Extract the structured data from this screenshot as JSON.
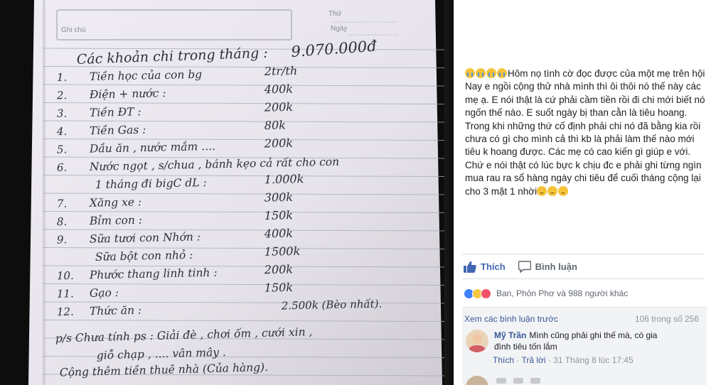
{
  "image": {
    "header": {
      "thu_label": "Thứ",
      "ngay_label": "Ngày",
      "ghi_chu_label": "Ghi chú"
    },
    "note": {
      "title": "Các khoản chi trong tháng :",
      "total": "9.070.000đ",
      "items": [
        {
          "num": "1.",
          "desc": "Tiền học của con bg",
          "amount": "2tr/th"
        },
        {
          "num": "2.",
          "desc": "Điện + nước :",
          "amount": "400k"
        },
        {
          "num": "3.",
          "desc": "Tiền ĐT :",
          "amount": "200k"
        },
        {
          "num": "4.",
          "desc": "Tiền Gas :",
          "amount": "80k"
        },
        {
          "num": "5.",
          "desc": "Dầu ăn , nước mắm ....",
          "amount": "200k"
        },
        {
          "num": "6.",
          "desc": "Nước ngọt , s/chua , bánh kẹo cả rất cho con",
          "amount": ""
        },
        {
          "num": "",
          "desc": "1 tháng đi bigC dL :",
          "amount": "1.000k"
        },
        {
          "num": "7.",
          "desc": "Xăng xe :",
          "amount": "300k"
        },
        {
          "num": "8.",
          "desc": "Bỉm con :",
          "amount": "150k"
        },
        {
          "num": "9.",
          "desc": "Sữa tươi con Nhớn :",
          "amount": "400k"
        },
        {
          "num": "",
          "desc": "Sữa bột con nhỏ :",
          "amount": "1500k"
        },
        {
          "num": "10.",
          "desc": "Phước thang linh tinh :",
          "amount": "200k"
        },
        {
          "num": "11.",
          "desc": "Gạo :",
          "amount": "150k"
        },
        {
          "num": "12.",
          "desc": "Thức ăn :",
          "amount": "2.500k (Bèo nhất)."
        }
      ],
      "footer_lines": [
        "p/s Chưa tính ps : Giải đè , chơi ốm , cưới xin ,",
        "giỗ chạp , .... vân mây .",
        "Cộng thêm tiền thuê nhà (Của hàng)."
      ]
    }
  },
  "post": {
    "emojis": [
      "crying-face",
      "crying-face",
      "crying-face",
      "crying-face"
    ],
    "paragraphs": [
      "Hôm nọ tình cờ đọc được của một mẹ trên hội",
      "Nay e ngồi cộng thử nhà mình thì ôi thôi nó thế này các mẹ ạ. E nói thật là cứ phải cầm tiền rồi đi chi mới biết nó ngốn thế nào. E suốt ngày bị than cằn là tiêu hoang. Trong khi những thứ cố định phải chi nó đã bằng kia rồi chưa có gì cho mình cả thì kb là phải làm thế nào mới tiêu k hoang được. Các mẹ có cao kiến gì giúp e với. Chứ e nói thật có lúc bực k chịu đc e phải ghi từng ngìn mua rau ra sổ hàng ngày chi tiêu để cuối tháng cộng lại cho 3 mặt 1 nhời"
    ],
    "end_emojis": [
      "sad-face",
      "sad-face",
      "sad-face"
    ]
  },
  "actions": {
    "like": "Thích",
    "comment": "Bình luận"
  },
  "reactions": {
    "summary": "Ban, Phỏn Phơ và 988 người khác"
  },
  "comments": {
    "view_previous": "Xem các bình luận trước",
    "count": "106 trong số 256",
    "items": [
      {
        "author": "Mỹ Trần",
        "text": "Mình cũng phải ghi thế mà, có gia đình tiêu tốn lắm",
        "like": "Thích",
        "reply": "Trả lời",
        "time": "31 Tháng 8 lúc 17:45"
      }
    ]
  },
  "colors": {
    "paper": "#e9e7ee",
    "ink": "#2c2f3c",
    "facebook_blue": "#4267b2",
    "link": "#385898"
  }
}
